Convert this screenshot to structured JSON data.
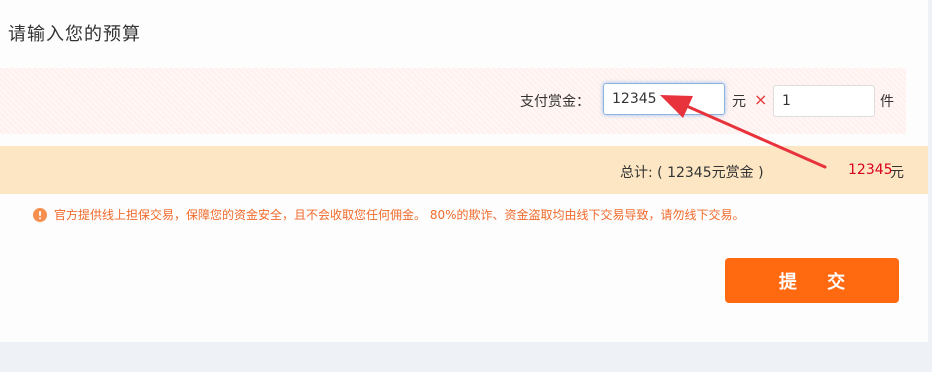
{
  "page": {
    "title": "请输入您的预算"
  },
  "budget": {
    "reward_label": "支付赏金：",
    "reward_value": "12345",
    "unit_yuan": "元",
    "multiply_sign": "×",
    "quantity_value": "1",
    "unit_piece": "件"
  },
  "total": {
    "label": "总计: ( 12345元赏金 )",
    "amount": "12345",
    "unit": "元"
  },
  "notice": {
    "icon": "warning-circle-icon",
    "text": "官方提供线上担保交易，保障您的资金安全，且不会收取您任何佣金。 80%的欺诈、资金盗取均由线下交易导致，请勿线下交易。"
  },
  "actions": {
    "submit_label": "提 交"
  },
  "colors": {
    "accent": "#ff6a11",
    "total_amount": "#d9001b",
    "notice_text": "#f06a2b",
    "total_bar": "#fde6c4",
    "budget_row": "#fff3f1",
    "annotation_arrow": "#e8333c"
  }
}
